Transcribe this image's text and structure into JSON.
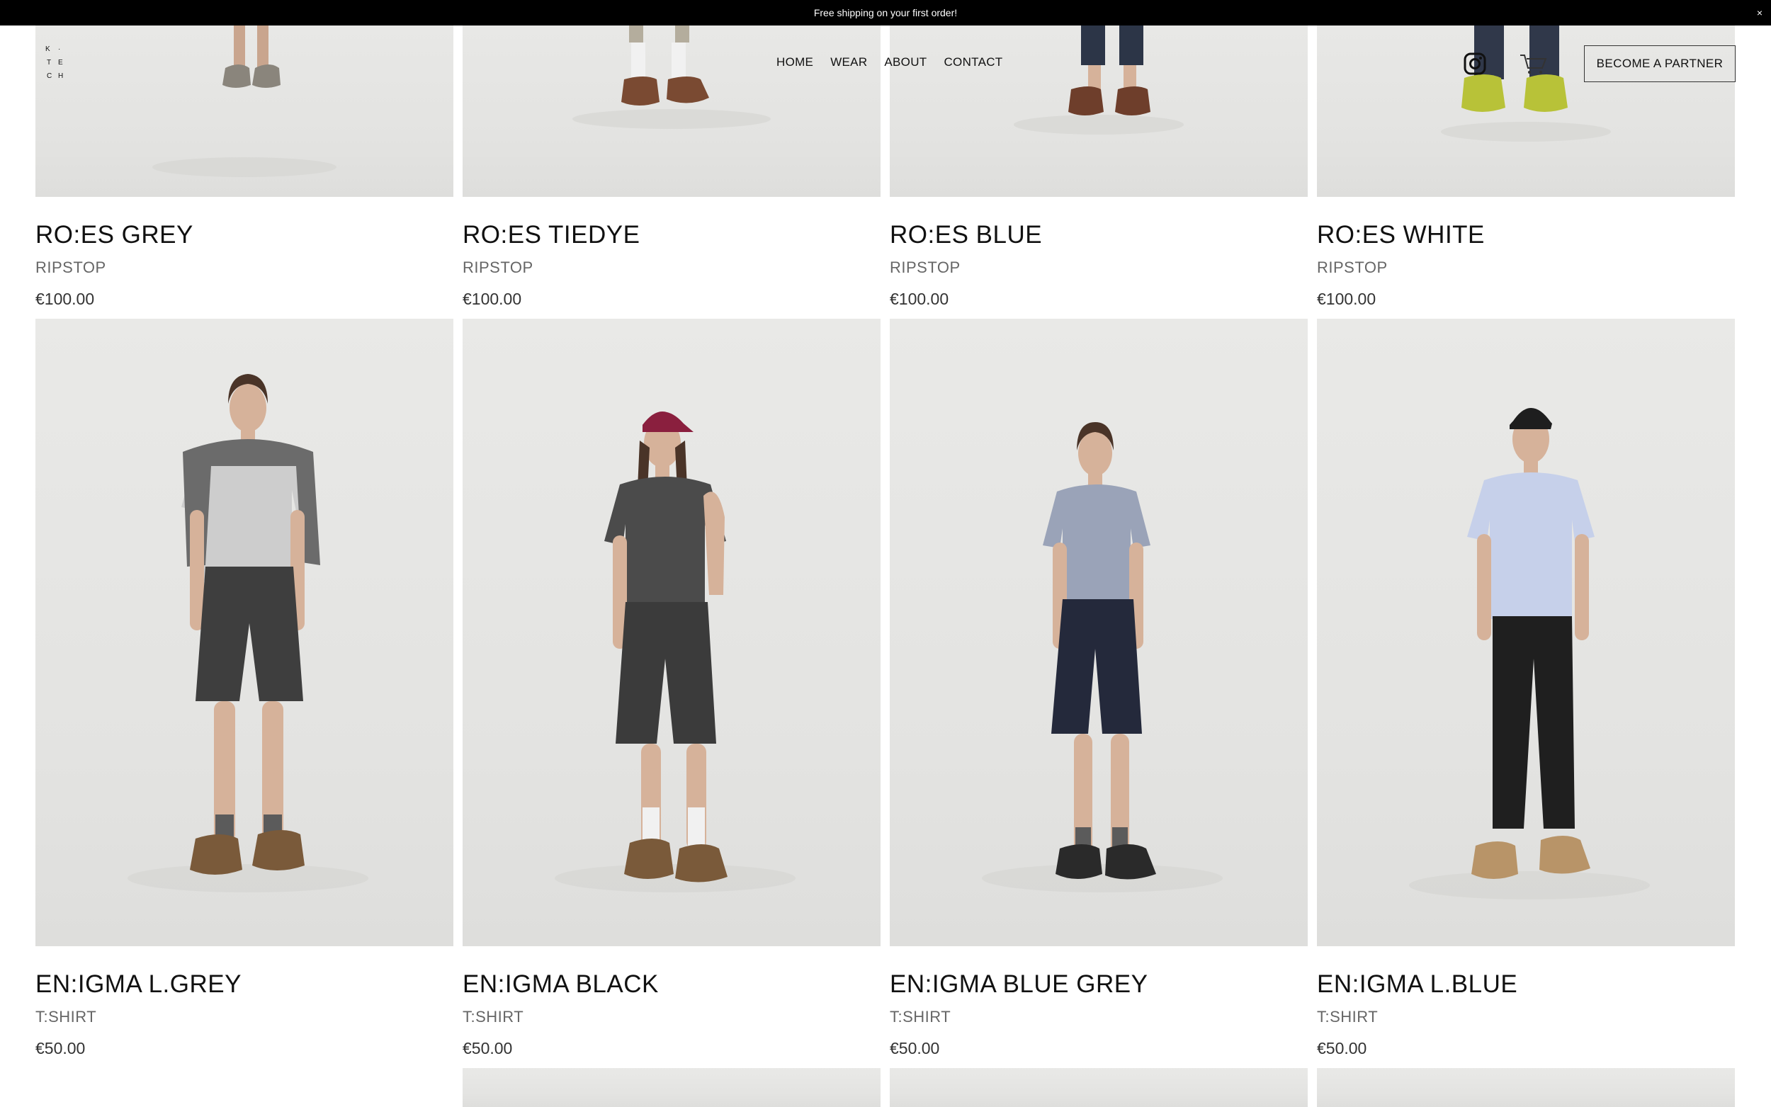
{
  "announcement": {
    "text": "Free shipping on your first order!",
    "close": "×"
  },
  "logo": {
    "letters": [
      "K",
      "·",
      "T",
      "E",
      "C",
      "H"
    ]
  },
  "nav": {
    "items": [
      "HOME",
      "WEAR",
      "ABOUT",
      "CONTACT"
    ]
  },
  "header": {
    "instagram_icon": "instagram-icon",
    "cart_icon": "cart-icon",
    "partner_label": "BECOME A PARTNER"
  },
  "products": [
    {
      "name": "RO:ES GREY",
      "category": "RIPSTOP",
      "price": "€100.00",
      "shirt": "#c9c9c9",
      "bottom": "#8b8b86",
      "shoes": "#8a857c",
      "skin": "#c9a58e",
      "hair": "#5a4033"
    },
    {
      "name": "RO:ES TIEDYE",
      "category": "RIPSTOP",
      "price": "€100.00",
      "shirt": "#5a5a5a",
      "bottom": "#b4ad9d",
      "shoes": "#7a4a32",
      "skin": "#d6b29a",
      "hair": "#4a3428"
    },
    {
      "name": "RO:ES BLUE",
      "category": "RIPSTOP",
      "price": "€100.00",
      "shirt": "#8e98ac",
      "bottom": "#2c3547",
      "shoes": "#6e3e2b",
      "skin": "#d6b29a",
      "hair": "#4a3428"
    },
    {
      "name": "RO:ES WHITE",
      "category": "RIPSTOP",
      "price": "€100.00",
      "shirt": "#c8d2e8",
      "bottom": "#30384a",
      "shoes": "#b8c238",
      "skin": "#d6b29a",
      "hair": "#2b2b2b"
    },
    {
      "name": "EN:IGMA L.GREY",
      "category": "T:SHIRT",
      "price": "€50.00",
      "shirt": "#cdcdcd",
      "bottom": "#3e3e3e",
      "shoes": "#7a5a3a",
      "skin": "#d6b29a",
      "hair": "#4a3428",
      "wrap": "#6b6b6b"
    },
    {
      "name": "EN:IGMA BLACK",
      "category": "T:SHIRT",
      "price": "€50.00",
      "shirt": "#4b4b4b",
      "bottom": "#3b3b3b",
      "shoes": "#7a5a3a",
      "skin": "#d6b29a",
      "hair": "#4a3428",
      "cap": "#8a1f3e"
    },
    {
      "name": "EN:IGMA BLUE GREY",
      "category": "T:SHIRT",
      "price": "€50.00",
      "shirt": "#9aa3b8",
      "bottom": "#24293b",
      "shoes": "#2a2a2a",
      "skin": "#d6b29a",
      "hair": "#4a3428"
    },
    {
      "name": "EN:IGMA L.BLUE",
      "category": "T:SHIRT",
      "price": "€50.00",
      "shirt": "#c6d0ea",
      "bottom": "#1f1f1f",
      "shoes": "#b89468",
      "skin": "#d6b29a",
      "hair": "#2b2b2b",
      "cap": "#1e1e1e"
    }
  ]
}
